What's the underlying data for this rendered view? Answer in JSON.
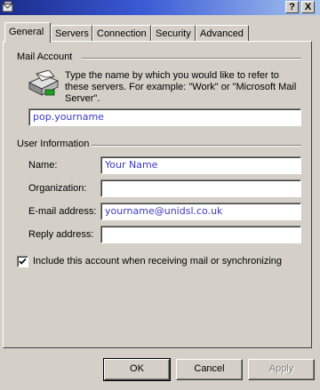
{
  "window": {
    "help_button": "?",
    "close_button": "X"
  },
  "tabs": [
    {
      "label": "General"
    },
    {
      "label": "Servers"
    },
    {
      "label": "Connection"
    },
    {
      "label": "Security"
    },
    {
      "label": "Advanced"
    }
  ],
  "mail_account": {
    "group_label": "Mail Account",
    "description": "Type the name by which you would like to refer to these servers.  For example: \"Work\" or \"Microsoft Mail Server\".",
    "account_name_value": "pop.yourname"
  },
  "user_information": {
    "group_label": "User Information",
    "name_label": "Name:",
    "name_value": "Your Name",
    "organization_label": "Organization:",
    "organization_value": "",
    "email_label": "E-mail address:",
    "email_value": "yourname@unidsl.co.uk",
    "reply_label": "Reply address:",
    "reply_value": ""
  },
  "include_account": {
    "checked": true,
    "label": "Include this account when receiving mail or synchronizing"
  },
  "buttons": {
    "ok": "OK",
    "cancel": "Cancel",
    "apply": "Apply"
  },
  "colors": {
    "field_text": "#3a3ad0",
    "dialog_face": "#d4d0c8",
    "titlebar_dark": "#1a2b8a"
  }
}
